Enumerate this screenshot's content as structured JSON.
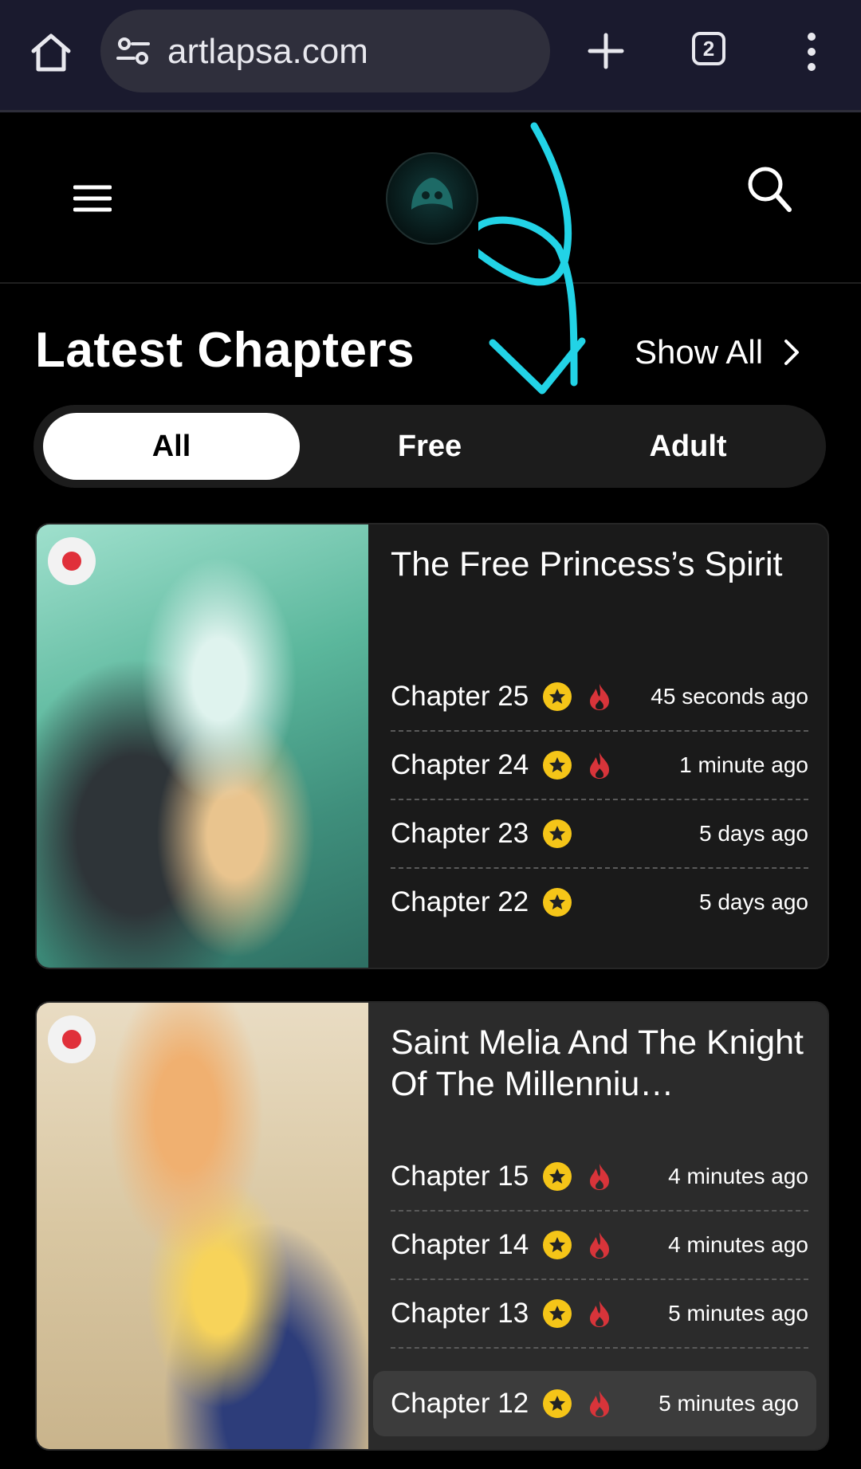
{
  "browser": {
    "url": "artlapsa.com",
    "tab_count": "2",
    "icons": [
      "home-icon",
      "site-settings-icon",
      "new-tab-icon",
      "tab-switcher-icon",
      "more-vert-icon"
    ]
  },
  "header": {
    "icons": [
      "hamburger-menu-icon",
      "site-logo",
      "search-icon"
    ]
  },
  "section": {
    "title": "Latest Chapters",
    "show_all": "Show All"
  },
  "filters": {
    "tabs": [
      {
        "label": "All",
        "active": true
      },
      {
        "label": "Free",
        "active": false
      },
      {
        "label": "Adult",
        "active": false
      }
    ]
  },
  "cards": [
    {
      "title": "The Free Princess’s Spirit",
      "cover_badge_color": "#e0303a",
      "chapters": [
        {
          "label": "Chapter 25",
          "star": true,
          "hot": true,
          "time": "45 seconds ago"
        },
        {
          "label": "Chapter 24",
          "star": true,
          "hot": true,
          "time": "1 minute ago"
        },
        {
          "label": "Chapter 23",
          "star": true,
          "hot": false,
          "time": "5 days ago"
        },
        {
          "label": "Chapter 22",
          "star": true,
          "hot": false,
          "time": "5 days ago"
        }
      ]
    },
    {
      "title": "Saint Melia And The Knight Of The Millenniu…",
      "cover_badge_color": "#e0303a",
      "chapters": [
        {
          "label": "Chapter 15",
          "star": true,
          "hot": true,
          "time": "4 minutes ago"
        },
        {
          "label": "Chapter 14",
          "star": true,
          "hot": true,
          "time": "4 minutes ago"
        },
        {
          "label": "Chapter 13",
          "star": true,
          "hot": true,
          "time": "5 minutes ago"
        },
        {
          "label": "Chapter 12",
          "star": true,
          "hot": true,
          "time": "5 minutes ago"
        }
      ]
    }
  ],
  "colors": {
    "star": "#f5c518",
    "fire": "#d8343a",
    "annotation_arrow": "#22d3e6"
  }
}
